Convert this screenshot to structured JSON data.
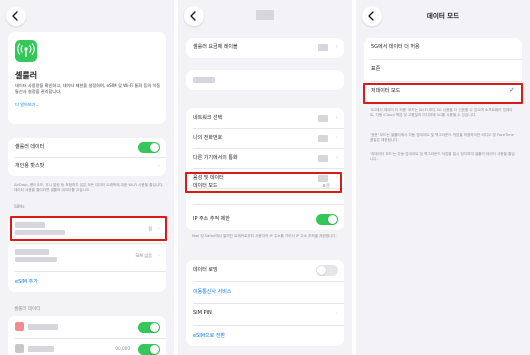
{
  "panel1": {
    "app_icon": "antenna-radiowaves-icon",
    "title": "셀룰러",
    "description": "데이터 사용량을 확인하고, 데이터 제한을 설정하며, eSIM 및 Wi-Fi 통화 등의 이동통신사 설정을 관리합니다.",
    "learn_more": "더 알아보기...",
    "cellular_data_label": "셀룰러 데이터",
    "cellular_data_on": true,
    "hotspot_label": "개인용 핫스팟",
    "hotspot_footnote": "AirDrop, 핸드오프, 무시 알림 등 포함하지 않은 모든 데이터 트래픽에 대한 Wi-Fi 사용을 줄입니다. 데이터 사용을 줄이려면 셀룰러 데이터를 끄십시오.",
    "sims_header": "SIMs",
    "sim1_value": "켬",
    "sim2_value": "SIM 없음",
    "add_esim": "eSIM 추가",
    "cellular_data_section": "셀룰러 데이터",
    "app_row_value": "00,000"
  },
  "panel2": {
    "carrier_services": "셀룰러 요금제 레이블",
    "network_selection": "네트워크 선택",
    "my_number": "나의 전화번호",
    "calls_on_other_devices": "다른 기기에서의 통화",
    "voice_data": "음성 및 데이터",
    "data_mode": "데이터 모드",
    "data_mode_value": "표준",
    "limit_ip_tracking": "IP 주소 추적 제한",
    "limit_ip_on": true,
    "ip_footnote": "Mail 및 Safari에서 알려진 트래커로부터 사용자의 IP 주소를 가려서 IP 주소 추적을 제한합니다.",
    "data_roaming": "데이터 로밍",
    "data_roaming_on": false,
    "carrier_services_link": "이동통신사 서비스",
    "sim_pin": "SIM PIN",
    "convert_to_esim": "eSIM으로 전환"
  },
  "panel3": {
    "title": "데이터 모드",
    "option_5g": "5G에서 데이터 더 허용",
    "option_standard": "표준",
    "option_low": "저데이터 모드",
    "selected": "저데이터 모드",
    "footnote_1": "'5G에서 데이터 더 허용' 모드는 Wi-Fi 보다 5G 사용을 더 선호할 수 있으며 소프트웨어 업데이트, 자동 iCloud 백업 및 고품질의 미디어에 5G를 사용할 수 있습니다.",
    "footnote_2": "'표준' 모드는 셀룰러에서 자동 업데이트 및 백그라운드 작업을 허용하지만 비디오 및 FaceTime 품질은 제한됩니다.",
    "footnote_3": "'저데이터 모드'는 자동 업데이트 및 백그라운드 작업을 일시 정지하여 셀룰러 데이터 사용을 줄입니다."
  },
  "colors": {
    "accent": "#0a7aff",
    "toggle_on": "#34c759",
    "highlight": "#d91b1b",
    "background": "#f2f2f7"
  }
}
